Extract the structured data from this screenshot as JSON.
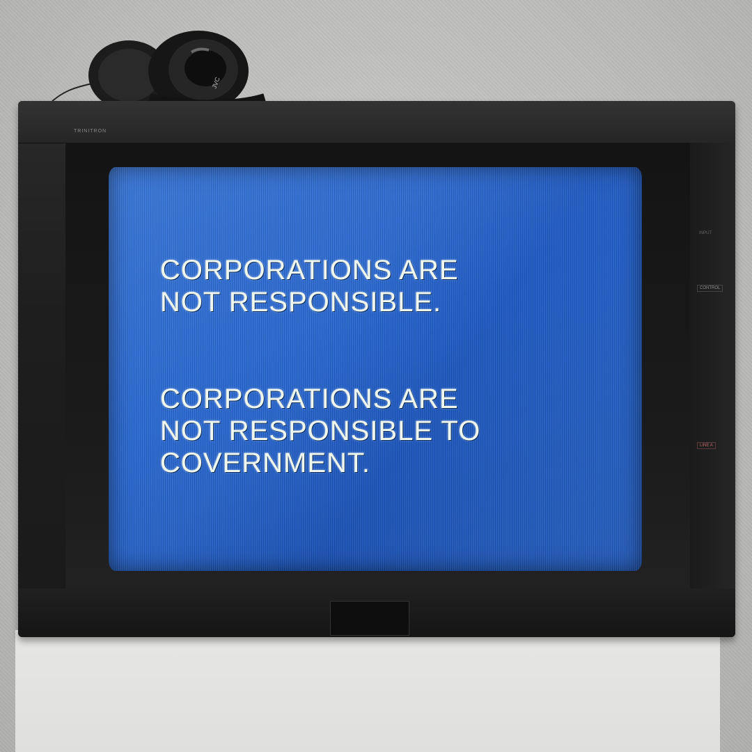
{
  "scene": {
    "wall_color": "#c4c4c2",
    "pedestal_color": "#e2e2e0",
    "tv_color": "#1e1e1e",
    "screen_color": "#2a68d0",
    "screen_text_color": "#eef6ee"
  },
  "tv": {
    "brand_label": "TRINITRON",
    "side_labels": {
      "input": "INPUT",
      "control": "CONTROL",
      "line": "LINE A"
    }
  },
  "headphones": {
    "brand_label": "JVC",
    "icon": "headphones-icon"
  },
  "screen": {
    "blocks": [
      {
        "lines": [
          "CORPORATIONS ARE",
          "NOT RESPONSIBLE."
        ]
      },
      {
        "lines": [
          "CORPORATIONS ARE",
          "NOT RESPONSIBLE TO",
          "COVERNMENT."
        ]
      }
    ]
  }
}
